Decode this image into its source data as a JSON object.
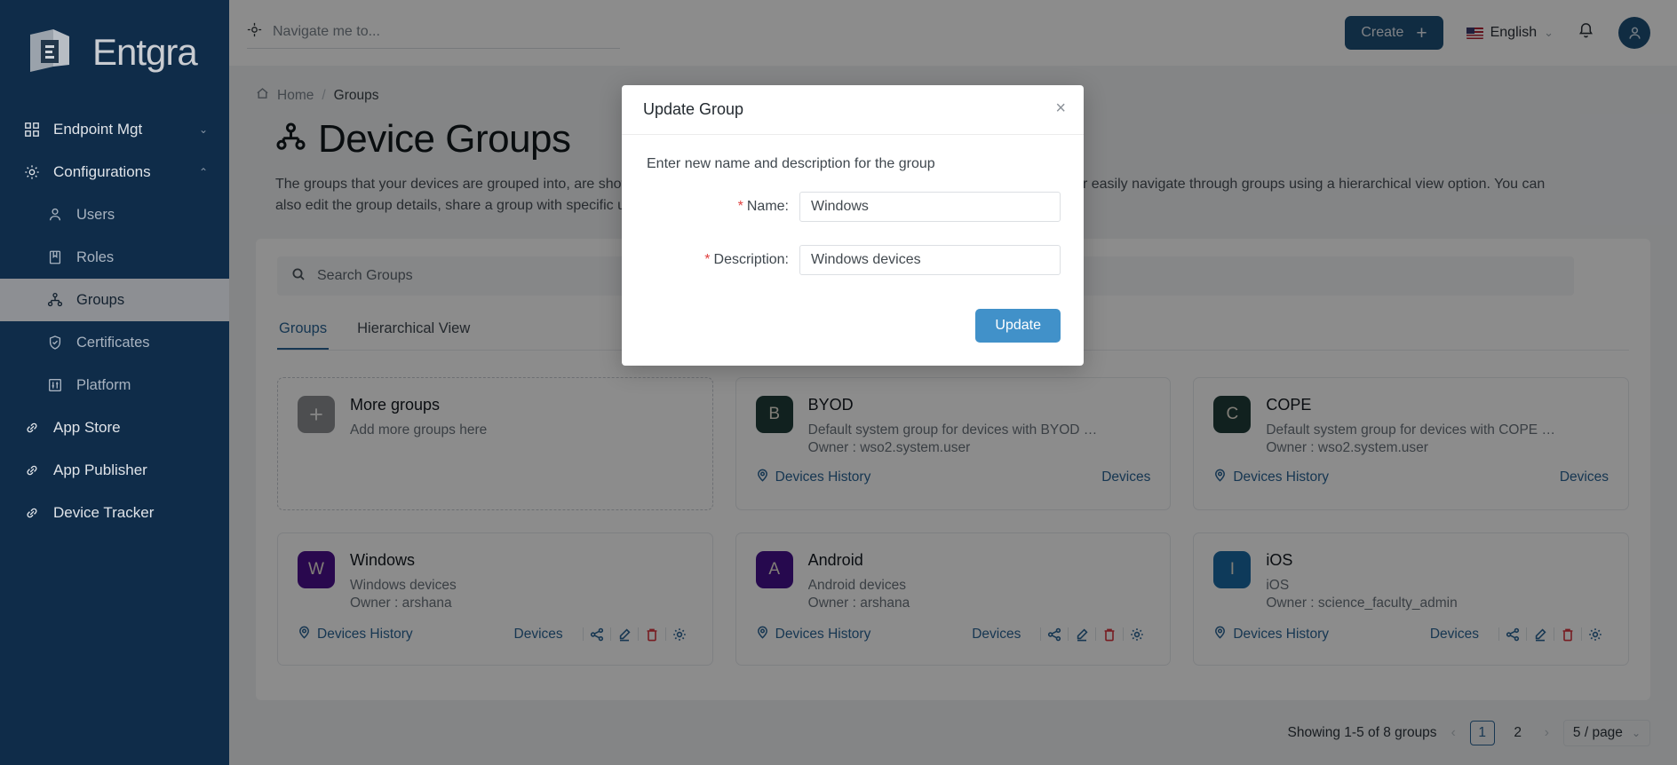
{
  "sidebar": {
    "brand": "Entgra",
    "items": [
      {
        "label": "Endpoint Mgt",
        "icon": "grid-icon",
        "level": "top",
        "expandable": true,
        "expanded": false,
        "active": false
      },
      {
        "label": "Configurations",
        "icon": "gear-icon",
        "level": "top",
        "expandable": true,
        "expanded": true,
        "active": false
      },
      {
        "label": "Users",
        "icon": "user-icon",
        "level": "sub",
        "active": false
      },
      {
        "label": "Roles",
        "icon": "book-icon",
        "level": "sub",
        "active": false
      },
      {
        "label": "Groups",
        "icon": "groups-icon",
        "level": "sub",
        "active": true
      },
      {
        "label": "Certificates",
        "icon": "shield-check-icon",
        "level": "sub",
        "active": false
      },
      {
        "label": "Platform",
        "icon": "sliders-icon",
        "level": "sub",
        "active": false
      },
      {
        "label": "App Store",
        "icon": "link-icon",
        "level": "top",
        "active": false
      },
      {
        "label": "App Publisher",
        "icon": "link-icon",
        "level": "top",
        "active": false
      },
      {
        "label": "Device Tracker",
        "icon": "link-icon",
        "level": "top",
        "active": false
      }
    ]
  },
  "topbar": {
    "nav_search_placeholder": "Navigate me to...",
    "create_label": "Create",
    "create_plus": "+",
    "language": "English",
    "notifications_icon": "bell-icon",
    "avatar_icon": "user-avatar-icon"
  },
  "breadcrumb": {
    "home": "Home",
    "separator": "/",
    "current": "Groups"
  },
  "page": {
    "title": "Device Groups",
    "description": "The groups that your devices are grouped into, are shown here. You can view the devices in a specified group by clicking them or easily navigate through groups using a hierarchical view option. You can also edit the group details, share a group with specific user roles, or delete a group under Actions."
  },
  "search": {
    "placeholder": "Search Groups"
  },
  "tabs": [
    {
      "label": "Groups",
      "active": true
    },
    {
      "label": "Hierarchical View",
      "active": false
    }
  ],
  "cards": [
    {
      "type": "add",
      "initial": "+",
      "avatar_color": "#8d8f93",
      "name": "More groups",
      "description": "Add more groups here"
    },
    {
      "type": "group",
      "initial": "B",
      "avatar_color": "#1f3c3a",
      "name": "BYOD",
      "description": "Default system group for devices with BYOD owne...",
      "owner": "Owner : wso2.system.user",
      "devices_history": "Devices History",
      "devices": "Devices",
      "actions": []
    },
    {
      "type": "group",
      "initial": "C",
      "avatar_color": "#1f3c3a",
      "name": "COPE",
      "description": "Default system group for devices with COPE owne...",
      "owner": "Owner : wso2.system.user",
      "devices_history": "Devices History",
      "devices": "Devices",
      "actions": []
    },
    {
      "type": "group",
      "initial": "W",
      "avatar_color": "#4b0f8f",
      "name": "Windows",
      "description": "Windows devices",
      "owner": "Owner : arshana",
      "devices_history": "Devices History",
      "devices": "Devices",
      "actions": [
        "share-icon",
        "edit-icon",
        "delete-icon",
        "settings-icon"
      ]
    },
    {
      "type": "group",
      "initial": "A",
      "avatar_color": "#45118e",
      "name": "Android",
      "description": "Android devices",
      "owner": "Owner : arshana",
      "devices_history": "Devices History",
      "devices": "Devices",
      "actions": [
        "share-icon",
        "edit-icon",
        "delete-icon",
        "settings-icon"
      ]
    },
    {
      "type": "group",
      "initial": "I",
      "avatar_color": "#1b6ba5",
      "name": "iOS",
      "description": "iOS",
      "owner": "Owner : science_faculty_admin",
      "devices_history": "Devices History",
      "devices": "Devices",
      "actions": [
        "share-icon",
        "edit-icon",
        "delete-icon",
        "settings-icon"
      ]
    }
  ],
  "pagination": {
    "summary": "Showing 1-5 of 8 groups",
    "prev": "‹",
    "next": "›",
    "pages": [
      "1",
      "2"
    ],
    "active_page": "1",
    "page_size": "5 / page"
  },
  "modal": {
    "title": "Update Group",
    "close": "×",
    "intro": "Enter new name and description for the group",
    "name_label": "Name:",
    "name_value": "Windows",
    "description_label": "Description:",
    "description_value": "Windows devices",
    "required_mark": "*",
    "submit_label": "Update"
  },
  "colors": {
    "sidebar_bg": "#0f2c49",
    "accent_blue": "#2a6496",
    "create_btn": "#1e5079",
    "update_btn": "#4191c9",
    "danger_red": "#d9363e"
  }
}
